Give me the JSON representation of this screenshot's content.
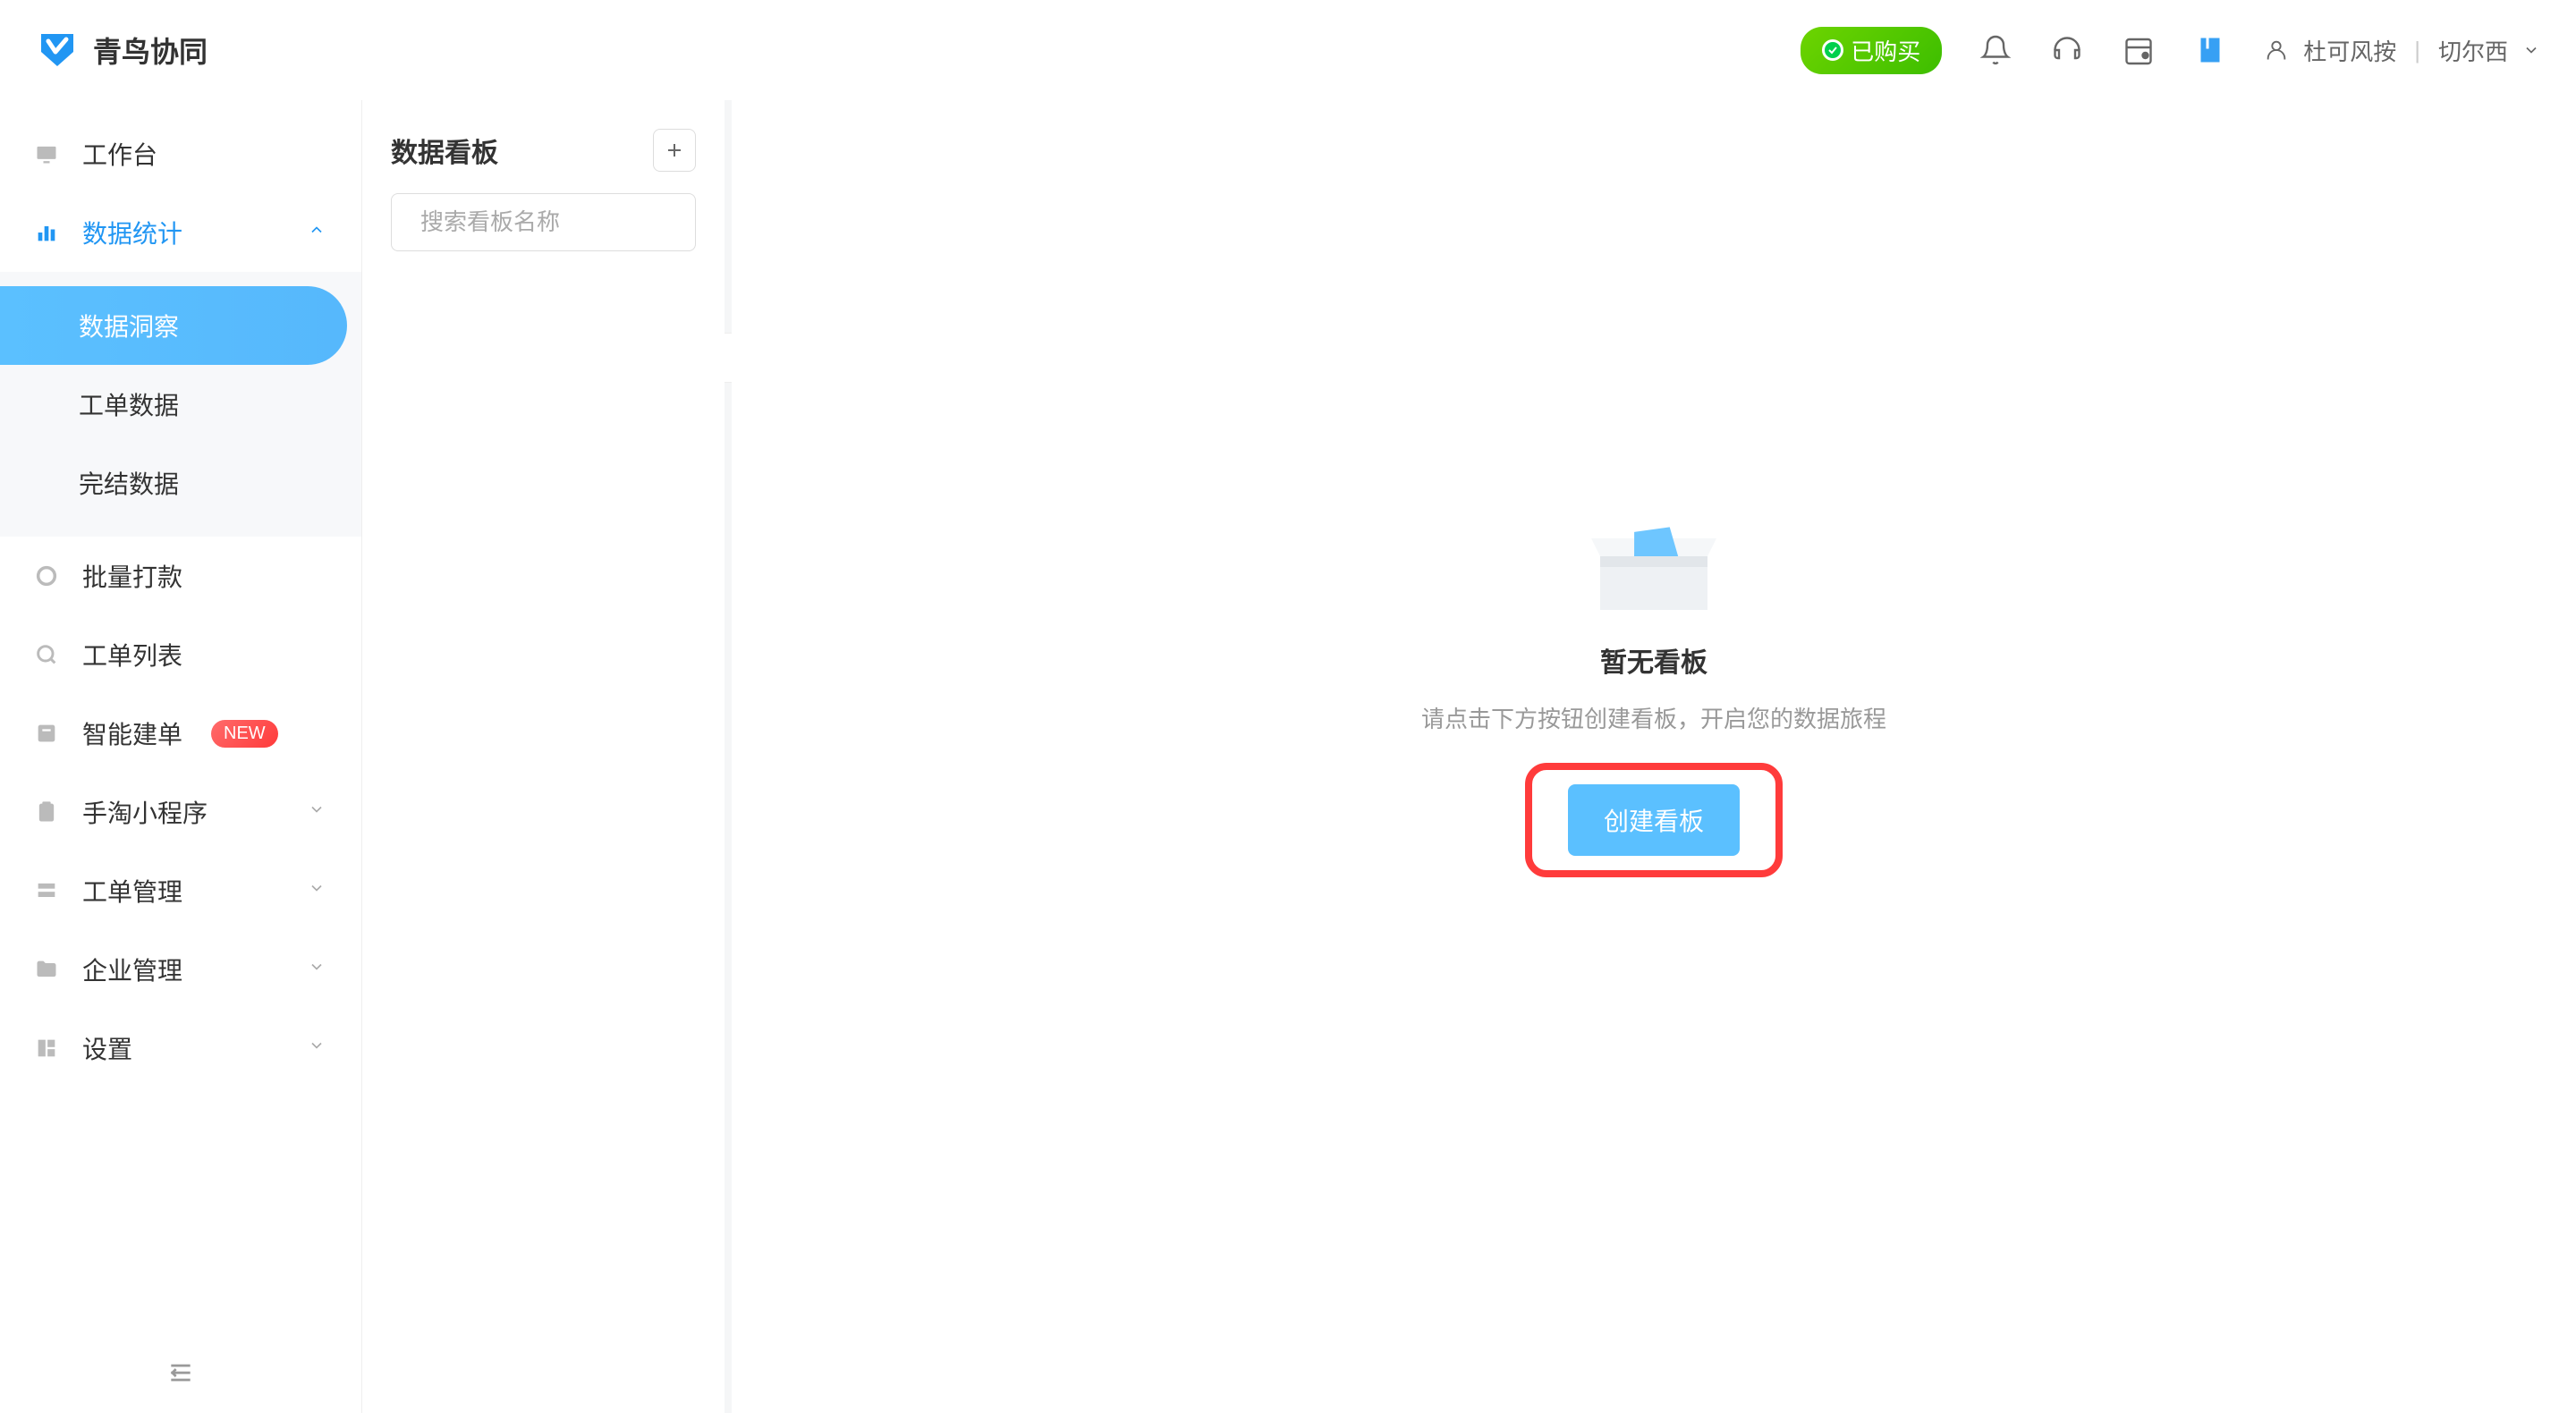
{
  "header": {
    "logo_text": "青鸟协同",
    "purchased_label": "已购买",
    "user_name": "杜可风按",
    "user_org": "切尔西"
  },
  "primary_nav": {
    "items": [
      {
        "label": "工作台",
        "icon": "monitor",
        "expandable": false
      },
      {
        "label": "数据统计",
        "icon": "chart-bar",
        "expandable": true,
        "expanded": true
      },
      {
        "label": "批量打款",
        "icon": "circle",
        "expandable": false
      },
      {
        "label": "工单列表",
        "icon": "search-circle",
        "expandable": false
      },
      {
        "label": "智能建单",
        "icon": "doc-square",
        "expandable": false,
        "badge": "NEW"
      },
      {
        "label": "手淘小程序",
        "icon": "clipboard",
        "expandable": true
      },
      {
        "label": "工单管理",
        "icon": "layers",
        "expandable": true
      },
      {
        "label": "企业管理",
        "icon": "folder",
        "expandable": true
      },
      {
        "label": "设置",
        "icon": "layout",
        "expandable": true
      }
    ],
    "sub_items": [
      {
        "label": "数据洞察",
        "active": true
      },
      {
        "label": "工单数据",
        "active": false
      },
      {
        "label": "完结数据",
        "active": false
      }
    ]
  },
  "secondary_sidebar": {
    "title": "数据看板",
    "search_placeholder": "搜索看板名称"
  },
  "empty_state": {
    "title": "暂无看板",
    "description": "请点击下方按钮创建看板，开启您的数据旅程",
    "button_label": "创建看板"
  }
}
